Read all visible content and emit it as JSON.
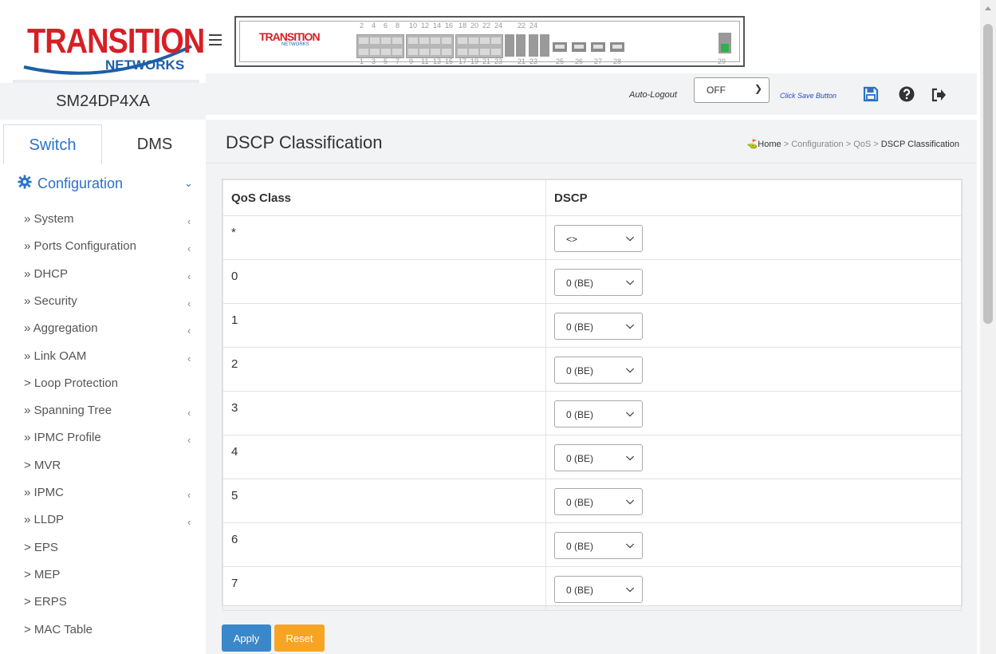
{
  "brand": {
    "logo_text": "TRANSITION",
    "logo_sub": "NETWORKS",
    "panel_logo_text": "TRANSITION",
    "panel_logo_sub": "NETWORKS"
  },
  "device_name": "SM24DP4XA",
  "tabs": {
    "switch": "Switch",
    "dms": "DMS"
  },
  "menu": {
    "section_label": "Configuration",
    "items": [
      {
        "label": "» System",
        "has_sub": true
      },
      {
        "label": "» Ports Configuration",
        "has_sub": true
      },
      {
        "label": "» DHCP",
        "has_sub": true
      },
      {
        "label": "» Security",
        "has_sub": true
      },
      {
        "label": "» Aggregation",
        "has_sub": true
      },
      {
        "label": "» Link OAM",
        "has_sub": true
      },
      {
        "label": "> Loop Protection",
        "has_sub": false
      },
      {
        "label": "» Spanning Tree",
        "has_sub": true
      },
      {
        "label": "» IPMC Profile",
        "has_sub": true
      },
      {
        "label": "> MVR",
        "has_sub": false
      },
      {
        "label": "» IPMC",
        "has_sub": true
      },
      {
        "label": "» LLDP",
        "has_sub": true
      },
      {
        "label": "> EPS",
        "has_sub": false
      },
      {
        "label": "> MEP",
        "has_sub": false
      },
      {
        "label": "> ERPS",
        "has_sub": false
      },
      {
        "label": "> MAC Table",
        "has_sub": false
      }
    ],
    "submenu_arrow": "‹"
  },
  "panel": {
    "top_numbers": [
      "2",
      "4",
      "6",
      "8",
      "10",
      "12",
      "14",
      "16",
      "18",
      "20",
      "22",
      "24",
      "22",
      "24"
    ],
    "bottom_numbers": [
      "1",
      "3",
      "5",
      "7",
      "9",
      "11",
      "13",
      "15",
      "17",
      "19",
      "21",
      "23",
      "21",
      "23",
      "25",
      "26",
      "27",
      "28",
      "29"
    ]
  },
  "header": {
    "autologout_label": "Auto-Logout",
    "autologout_value": "OFF",
    "save_hint": "Click Save Button"
  },
  "page": {
    "title": "DSCP Classification",
    "breadcrumb": {
      "home": "Home",
      "sep": ">",
      "items": [
        "Configuration",
        "QoS"
      ],
      "current": "DSCP Classification"
    }
  },
  "table": {
    "headers": {
      "qos_class": "QoS Class",
      "dscp": "DSCP"
    },
    "rows": [
      {
        "qos_class": "*",
        "dscp": "<>"
      },
      {
        "qos_class": "0",
        "dscp": "0 (BE)"
      },
      {
        "qos_class": "1",
        "dscp": "0 (BE)"
      },
      {
        "qos_class": "2",
        "dscp": "0 (BE)"
      },
      {
        "qos_class": "3",
        "dscp": "0 (BE)"
      },
      {
        "qos_class": "4",
        "dscp": "0 (BE)"
      },
      {
        "qos_class": "5",
        "dscp": "0 (BE)"
      },
      {
        "qos_class": "6",
        "dscp": "0 (BE)"
      },
      {
        "qos_class": "7",
        "dscp": "0 (BE)"
      }
    ]
  },
  "buttons": {
    "apply": "Apply",
    "reset": "Reset"
  },
  "colors": {
    "accent_blue": "#2a72c8",
    "apply_blue": "#3a87c9",
    "reset_orange": "#f7a425",
    "brand_red": "#d71f26",
    "port_green": "#2bb24c"
  }
}
